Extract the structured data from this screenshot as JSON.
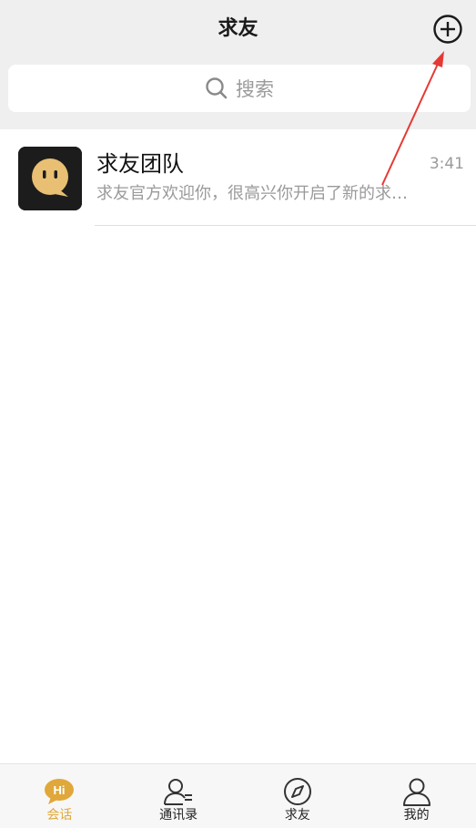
{
  "header": {
    "title": "求友",
    "add_icon": "plus-circle-icon"
  },
  "search": {
    "placeholder": "搜索",
    "icon": "search-icon"
  },
  "conversations": [
    {
      "name": "求友团队",
      "time": "3:41",
      "preview": "求友官方欢迎你，很高兴你开启了新的求…",
      "avatar_icon": "qiuyou-logo-icon"
    }
  ],
  "annotation": {
    "arrow_color": "#e53935"
  },
  "tabbar": {
    "active_color": "#e0a83a",
    "tabs": [
      {
        "label": "会话",
        "icon": "hi-chat-bubble-icon",
        "badge_text": "Hi",
        "active": true
      },
      {
        "label": "通讯录",
        "icon": "contacts-icon",
        "active": false
      },
      {
        "label": "求友",
        "icon": "compass-icon",
        "active": false
      },
      {
        "label": "我的",
        "icon": "person-icon",
        "active": false
      }
    ]
  }
}
